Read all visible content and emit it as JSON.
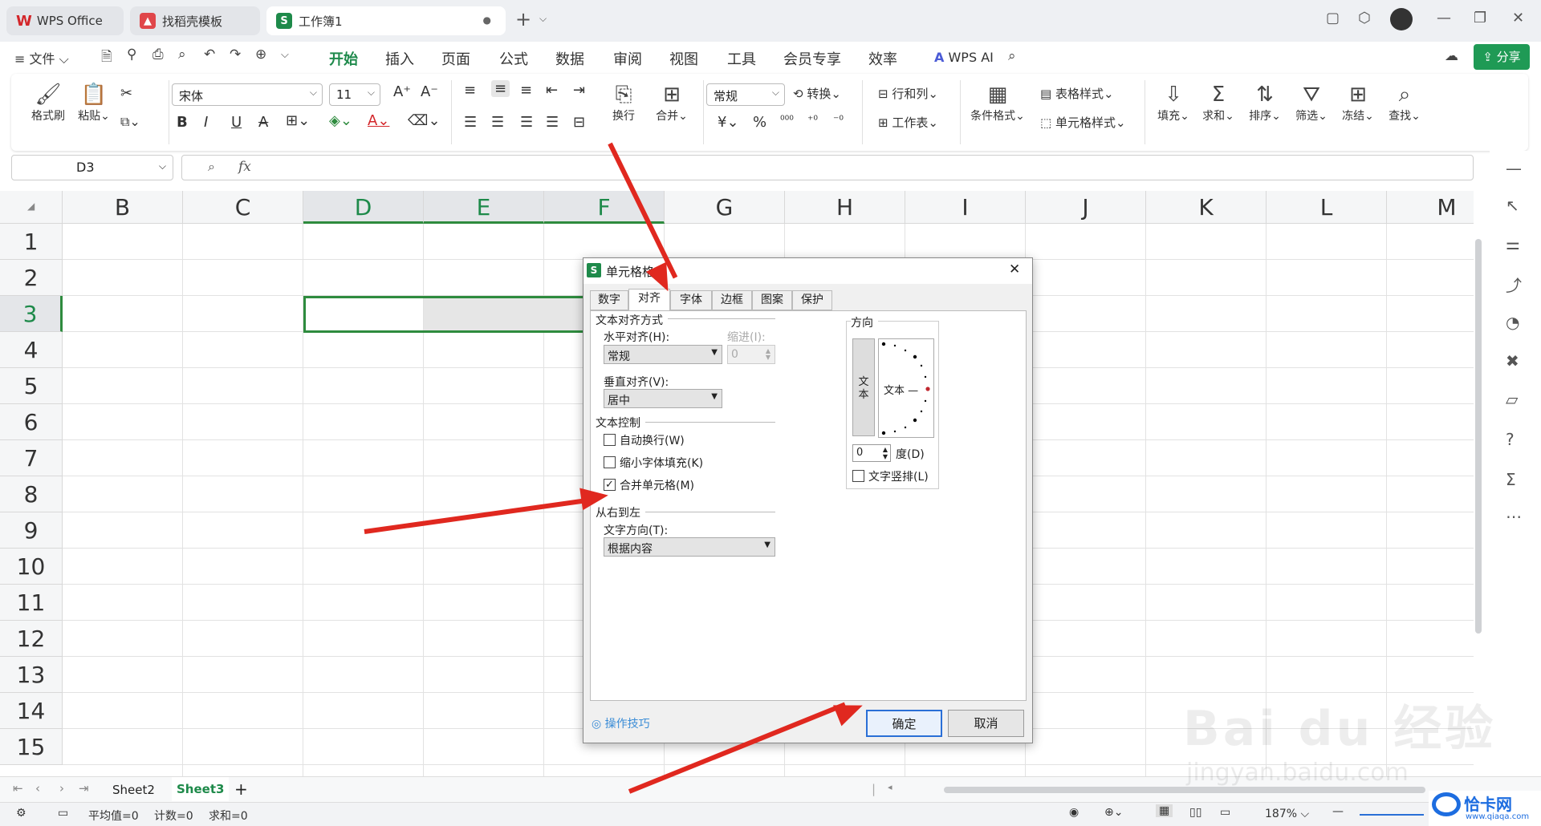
{
  "tabs": [
    {
      "label": "WPS Office"
    },
    {
      "label": "找稻壳模板"
    },
    {
      "label": "工作簿1"
    }
  ],
  "menu": {
    "file": "文件",
    "items": [
      "开始",
      "插入",
      "页面",
      "公式",
      "数据",
      "审阅",
      "视图",
      "工具",
      "会员专享",
      "效率"
    ],
    "ai": "WPS AI",
    "share": "分享"
  },
  "ribbon": {
    "format_painter": "格式刷",
    "paste": "粘贴",
    "font_name": "宋体",
    "font_size": "11",
    "wrap": "换行",
    "merge": "合并",
    "number_format": "常规",
    "convert": "转换",
    "row_col": "行和列",
    "worksheet": "工作表",
    "cond_format": "条件格式",
    "table_style": "表格样式",
    "cell_style": "单元格样式",
    "fill": "填充",
    "sum": "求和",
    "sort": "排序",
    "filter": "筛选",
    "freeze": "冻结",
    "find": "查找"
  },
  "formula": {
    "cell_ref": "D3",
    "fx": "fx"
  },
  "columns": [
    "B",
    "C",
    "D",
    "E",
    "F",
    "G",
    "H",
    "I",
    "J",
    "K",
    "L",
    "M"
  ],
  "rows": [
    "1",
    "2",
    "3",
    "4",
    "5",
    "6",
    "7",
    "8",
    "9",
    "10",
    "11",
    "12",
    "13",
    "14",
    "15"
  ],
  "sheets": [
    "Sheet2",
    "Sheet3"
  ],
  "status": {
    "avg": "平均值=0",
    "count": "计数=0",
    "sum": "求和=0",
    "zoom": "187%"
  },
  "dialog": {
    "title": "单元格格式",
    "tabs": [
      "数字",
      "对齐",
      "字体",
      "边框",
      "图案",
      "保护"
    ],
    "text_align_group": "文本对齐方式",
    "h_align_label": "水平对齐(H):",
    "h_align_value": "常规",
    "indent_label": "缩进(I):",
    "indent_value": "0",
    "v_align_label": "垂直对齐(V):",
    "v_align_value": "居中",
    "text_control_group": "文本控制",
    "wrap_text": "自动换行(W)",
    "shrink_fit": "缩小字体填充(K)",
    "merge_cells": "合并单元格(M)",
    "rtl_group": "从右到左",
    "text_dir_label": "文字方向(T):",
    "text_dir_value": "根据内容",
    "orientation_group": "方向",
    "vertical_text": "文\n本",
    "orient_text": "文本 —",
    "degree_value": "0",
    "degree_label": "度(D)",
    "vertical_layout": "文字竖排(L)",
    "tips": "操作技巧",
    "ok": "确定",
    "cancel": "取消"
  },
  "watermark": {
    "brand": "Bai du 经验",
    "url": "jingyan.baidu.com",
    "corner": "恰卡网",
    "corner_url": "www.qiaqa.com"
  },
  "colors": {
    "accent": "#1f8a4c",
    "arrow": "#e0281f",
    "ok_border": "#2a6fd6"
  }
}
